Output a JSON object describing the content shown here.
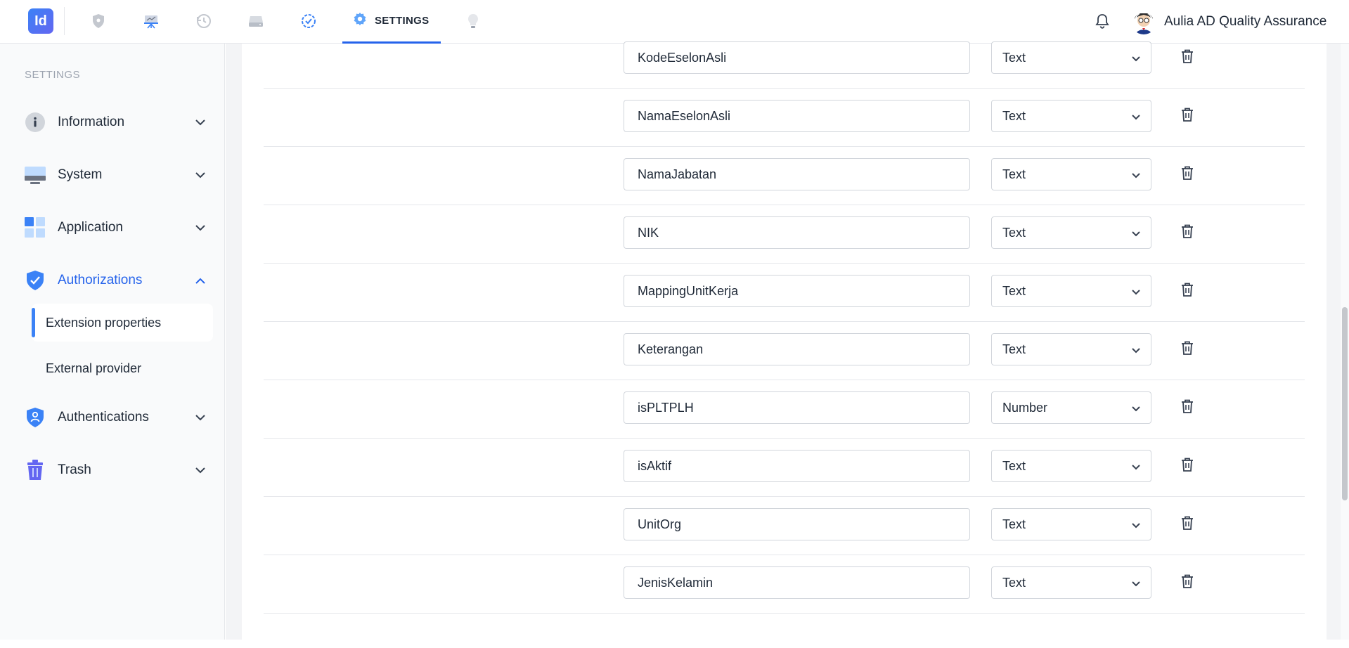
{
  "app": {
    "logo_text": "Id",
    "nav_icons": [
      "shield-icon",
      "presentation-icon",
      "history-icon",
      "drive-icon",
      "check-circle-icon",
      "gear-icon",
      "lightbulb-icon"
    ],
    "active_tab_label": "SETTINGS",
    "user_name": "Aulia AD Quality Assurance",
    "accent_color": "#2563eb"
  },
  "sidebar": {
    "heading": "SETTINGS",
    "items": [
      {
        "label": "Information",
        "icon": "info-icon",
        "expanded": false
      },
      {
        "label": "System",
        "icon": "monitor-icon",
        "expanded": false
      },
      {
        "label": "Application",
        "icon": "grid-icon",
        "expanded": false
      },
      {
        "label": "Authorizations",
        "icon": "shield-check-icon",
        "expanded": true
      },
      {
        "label": "Authentications",
        "icon": "shield-user-icon",
        "expanded": false
      },
      {
        "label": "Trash",
        "icon": "trash-icon",
        "expanded": false
      }
    ],
    "sub_items": [
      {
        "label": "Extension properties",
        "selected": true
      },
      {
        "label": "External provider",
        "selected": false
      }
    ]
  },
  "properties": {
    "rows": [
      {
        "name": "KodeEselonAsli",
        "type": "Text"
      },
      {
        "name": "NamaEselonAsli",
        "type": "Text"
      },
      {
        "name": "NamaJabatan",
        "type": "Text"
      },
      {
        "name": "NIK",
        "type": "Text"
      },
      {
        "name": "MappingUnitKerja",
        "type": "Text"
      },
      {
        "name": "Keterangan",
        "type": "Text"
      },
      {
        "name": "isPLTPLH",
        "type": "Number"
      },
      {
        "name": "isAktif",
        "type": "Text"
      },
      {
        "name": "UnitOrg",
        "type": "Text"
      },
      {
        "name": "JenisKelamin",
        "type": "Text"
      }
    ]
  }
}
